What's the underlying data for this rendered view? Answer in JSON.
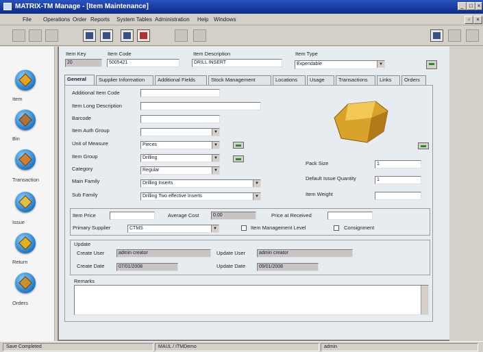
{
  "window": {
    "title": "MATRIX-TM Manage - [Item Maintenance]"
  },
  "menu": [
    "File",
    "Operations",
    "Order",
    "Reports",
    "System Tables",
    "Administration",
    "Help",
    "Windows"
  ],
  "sidebar": [
    {
      "label": "Item",
      "icon": "item-icon"
    },
    {
      "label": "Bin",
      "icon": "bin-icon"
    },
    {
      "label": "Transaction",
      "icon": "transaction-icon"
    },
    {
      "label": "Issue",
      "icon": "issue-icon"
    },
    {
      "label": "Return",
      "icon": "return-icon"
    },
    {
      "label": "Orders",
      "icon": "orders-icon"
    }
  ],
  "header": {
    "item_key_label": "Item Key",
    "item_key": "20",
    "item_code_label": "Item Code",
    "item_code": "5005421",
    "item_desc_label": "Item Description",
    "item_desc": "DRILL INSERT",
    "item_type_label": "Item Type",
    "item_type": "Expendable"
  },
  "tabs": [
    "General",
    "Supplier Information",
    "Additional Fields",
    "Stock Management",
    "Locations",
    "Usage",
    "Transactions",
    "Links",
    "Orders"
  ],
  "general": {
    "additional_code_label": "Additional Item Code",
    "long_desc_label": "Item Long Description",
    "barcode_label": "Barcode",
    "auth_group_label": "Item Auth Group",
    "uom_label": "Unit of Measure",
    "uom": "Pieces",
    "item_group_label": "Item Group",
    "item_group": "Drilling",
    "category_label": "Category",
    "category": "Regular",
    "main_family_label": "Main Family",
    "main_family": "Drilling Inserts",
    "sub_family_label": "Sub Family",
    "sub_family": "Drilling Two effective Inserts",
    "pack_size_label": "Pack Size",
    "pack_size": "1",
    "default_issue_qty_label": "Default Issue Quantity",
    "default_issue_qty": "1",
    "item_weight_label": "Item Weight"
  },
  "pricing": {
    "item_price_label": "Item Price",
    "average_cost_label": "Average Cost",
    "average_cost": "0.00",
    "price_received_label": "Price at Received",
    "primary_supplier_label": "Primary Supplier",
    "primary_supplier": "CTMS",
    "item_mgmt_label": "Item Management Level",
    "consignment_label": "Consignment"
  },
  "update": {
    "section_label": "Update",
    "create_user_label": "Create User",
    "create_user": "admin creator",
    "update_user_label": "Update User",
    "update_user": "admin creator",
    "create_date_label": "Create Date",
    "create_date": "07/01/2008",
    "update_date_label": "Update Date",
    "update_date": "09/01/2008"
  },
  "remarks": {
    "label": "Remarks"
  },
  "status": {
    "left": "Save Completed",
    "mid": "MAUL / ITMDemo",
    "right": "admin"
  },
  "colors": {
    "title_bar": "#0b2a8a",
    "form_bg": "#e6ecef",
    "insert_gold": "#d9a22b"
  }
}
